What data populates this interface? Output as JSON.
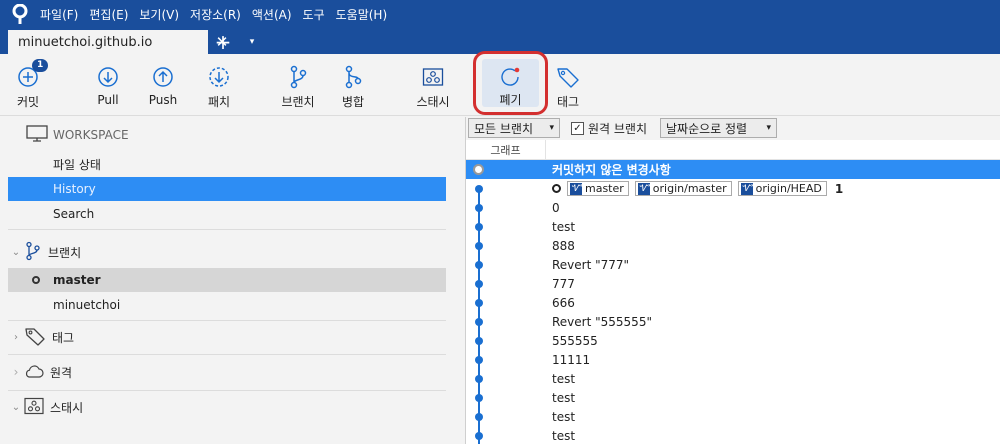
{
  "menubar": {
    "items": [
      "파일(F)",
      "편집(E)",
      "보기(V)",
      "저장소(R)",
      "액션(A)",
      "도구",
      "도움말(H)"
    ]
  },
  "tab": {
    "title": "minuetchoi.github.io",
    "close": "✕",
    "add": "+",
    "menu": "▾"
  },
  "toolbar": {
    "commit": {
      "label": "커밋",
      "badge": "1"
    },
    "pull": "Pull",
    "push": "Push",
    "fetch": "패치",
    "branch": "브랜치",
    "merge": "병합",
    "stash": "스태시",
    "discard": "폐기",
    "tag": "태그"
  },
  "sidebar": {
    "workspace": "WORKSPACE",
    "file_status": "파일 상태",
    "history": "History",
    "search": "Search",
    "branches": "브랜치",
    "branch_items": [
      "master",
      "minuetchoi"
    ],
    "tags": "태그",
    "remotes": "원격",
    "stashes": "스태시"
  },
  "filter": {
    "branches": "모든 브랜치",
    "remote_branches": "원격 브랜치",
    "sort": "날짜순으로 정렬",
    "remote_checked": true
  },
  "columns": {
    "graph": "그래프"
  },
  "commits": {
    "uncommitted": "커밋하지 않은 변경사항",
    "refs": [
      "master",
      "origin/master",
      "origin/HEAD"
    ],
    "ref_count": "1",
    "messages": [
      "0",
      "test",
      "888",
      "Revert \"777\"",
      "777",
      "666",
      "Revert \"555555\"",
      "555555",
      "11111",
      "test",
      "test",
      "test",
      "test"
    ]
  },
  "colors": {
    "accent": "#1a4e9c",
    "selection": "#2d8df4",
    "highlight": "#d32f2f"
  }
}
